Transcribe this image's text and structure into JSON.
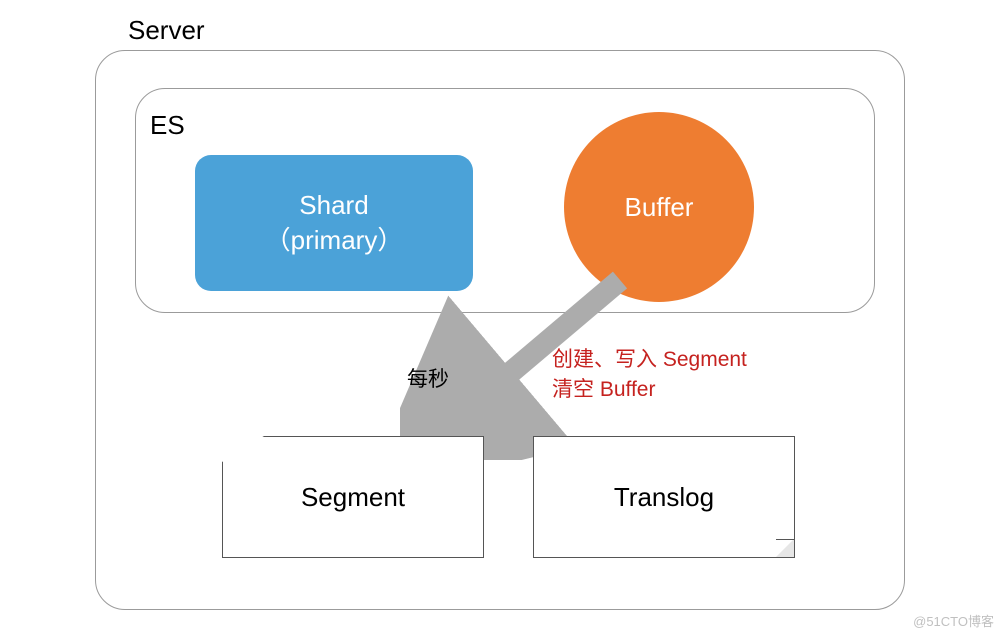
{
  "server": {
    "label": "Server"
  },
  "es": {
    "label": "ES"
  },
  "shard": {
    "line1": "Shard",
    "line2": "（primary）"
  },
  "buffer": {
    "label": "Buffer"
  },
  "labels": {
    "every_second": "每秒",
    "red_line1": "创建、写入 Segment",
    "red_line2": "清空 Buffer"
  },
  "segment": {
    "label": "Segment"
  },
  "translog": {
    "label": "Translog"
  },
  "watermark": "@51CTO博客"
}
